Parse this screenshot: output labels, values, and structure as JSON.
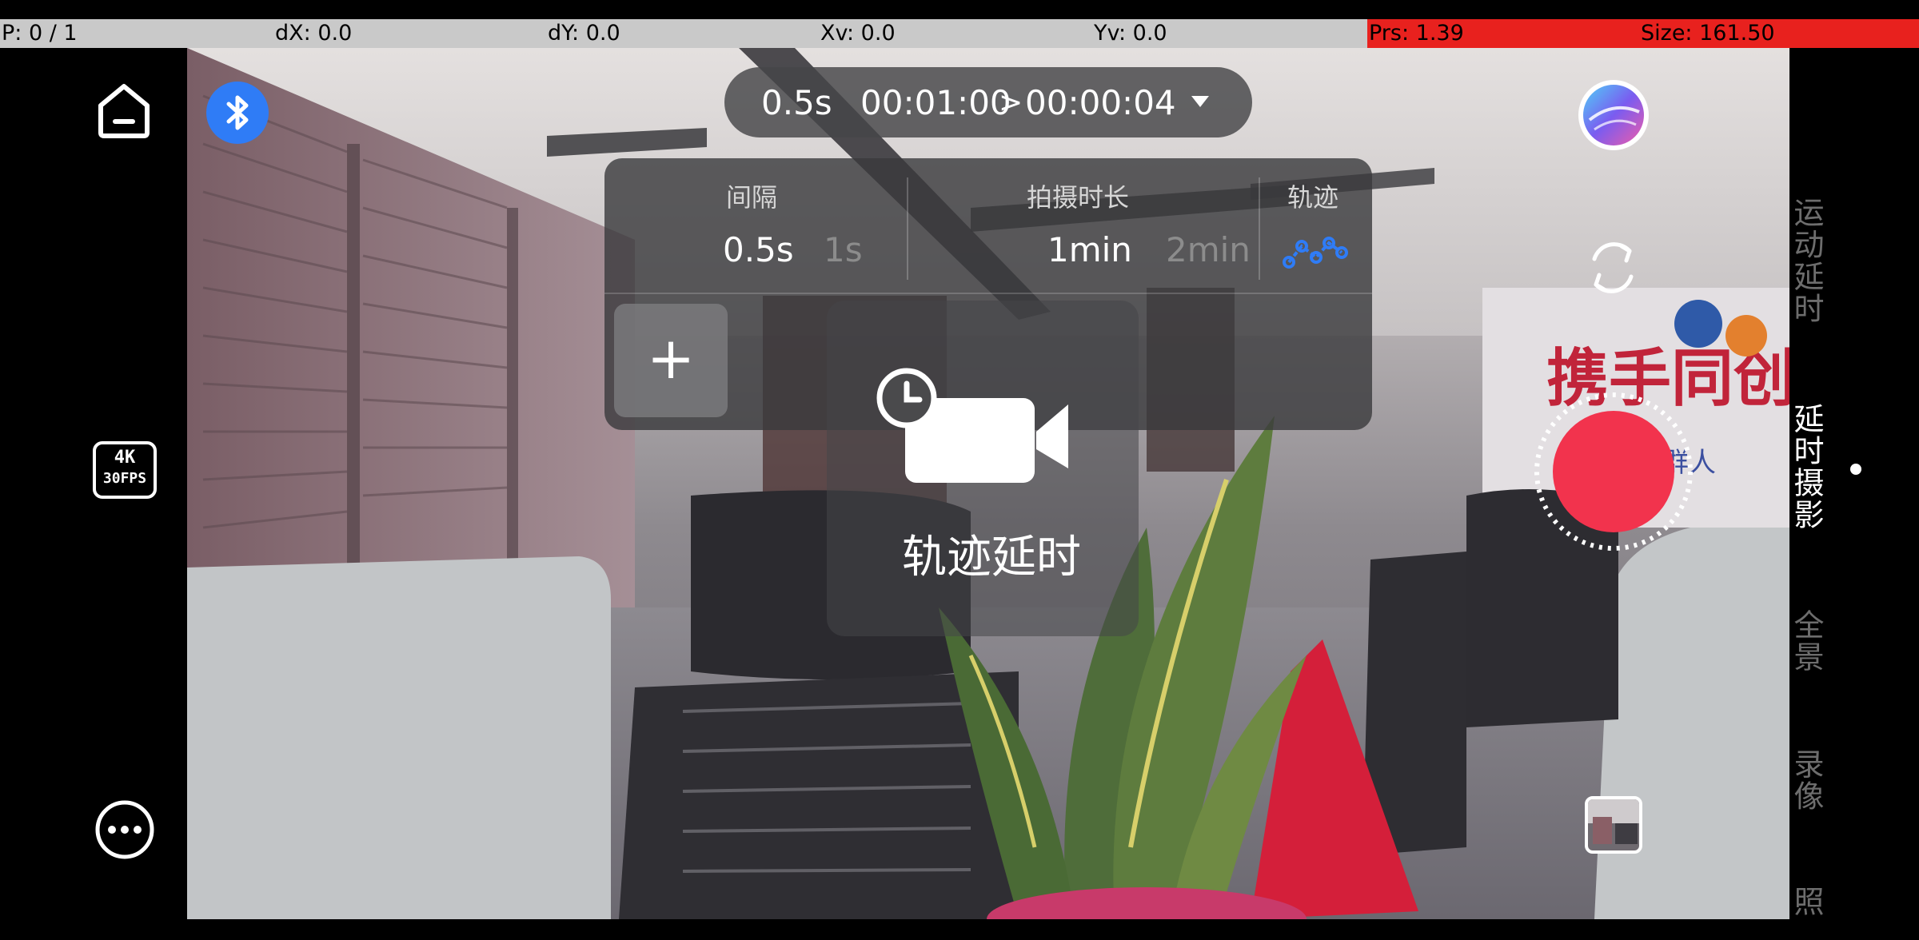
{
  "debug": {
    "p": "P: 0 / 1",
    "dx": "dX: 0.0",
    "dy": "dY: 0.0",
    "xv": "Xv: 0.0",
    "yv": "Yv: 0.0",
    "prs": "Prs: 1.39",
    "size": "Size: 161.50"
  },
  "left_rail": {
    "home_icon": "home-icon",
    "quality_badge_line1": "4K",
    "quality_badge_line2": "30FPS",
    "more_icon": "more-icon"
  },
  "bluetooth_icon": "bluetooth-icon",
  "top_pill": {
    "interval": "0.5s",
    "duration": "00:01:00",
    "arrow": ">",
    "output": "00:00:04",
    "dropdown_icon": "caret-down-icon"
  },
  "settings_panel": {
    "interval": {
      "label": "间隔",
      "options": [
        "0.5s",
        "1s"
      ],
      "selected": "0.5s"
    },
    "duration": {
      "label": "拍摄时长",
      "options": [
        "1min",
        "2min"
      ],
      "selected": "1min"
    },
    "path": {
      "label": "轨迹",
      "icon": "path-trajectory-icon"
    },
    "add_label": "+"
  },
  "mode_overlay": {
    "icon": "timelapse-camera-icon",
    "title": "轨迹延时"
  },
  "right_controls": {
    "avatar_icon": "gimbal-app-icon",
    "switch_camera_icon": "switch-camera-icon",
    "shutter_icon": "record-button",
    "gallery_icon": "gallery-thumbnail"
  },
  "modes": [
    {
      "label": "运动延时",
      "active": false
    },
    {
      "label": "延时摄影",
      "active": true
    },
    {
      "label": "全景",
      "active": false
    },
    {
      "label": "录像",
      "active": false
    },
    {
      "label": "照",
      "active": false
    }
  ],
  "colors": {
    "accent_blue": "#2f7cf6",
    "record_red": "#f2334d",
    "debug_red": "#e8211e"
  }
}
